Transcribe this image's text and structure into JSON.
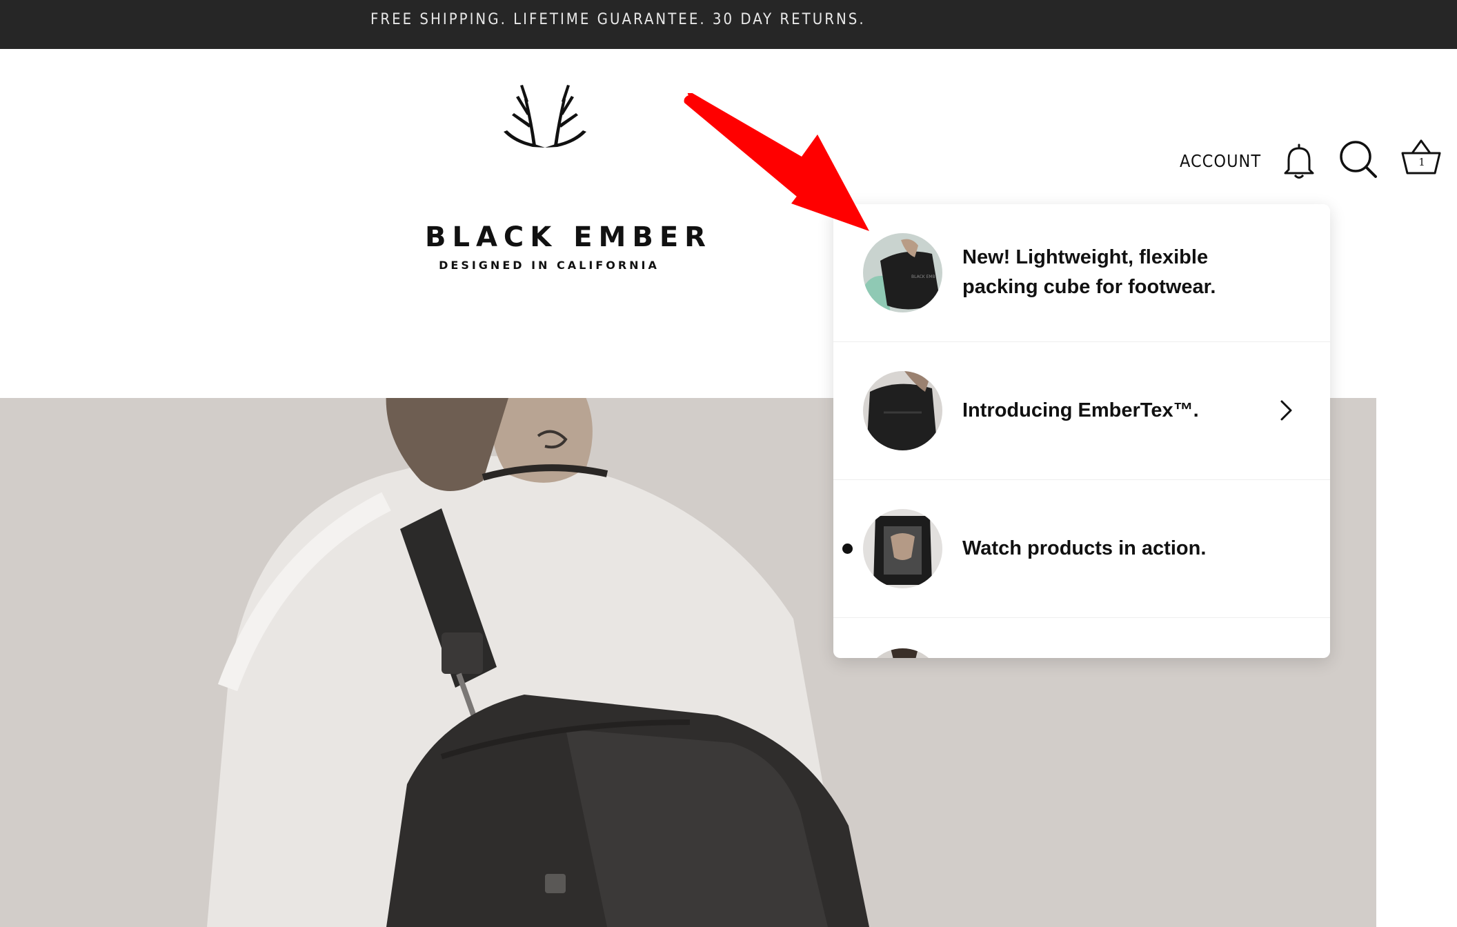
{
  "announcement": {
    "text": "FREE SHIPPING. LIFETIME GUARANTEE. 30 DAY RETURNS."
  },
  "brand": {
    "name": "BLACK EMBER",
    "tagline": "DESIGNED IN CALIFORNIA",
    "logo_icon": "antlers-logo"
  },
  "nav": {
    "account_label": "ACCOUNT",
    "icons": [
      "bell-icon",
      "search-icon",
      "basket-icon"
    ],
    "cart_count": "1"
  },
  "notifications": {
    "items": [
      {
        "line1": "New! Lightweight, flexible",
        "line2": "packing cube for footwear.",
        "has_chevron": false,
        "unread": false
      },
      {
        "line1": "Introducing EmberTex™.",
        "has_chevron": true,
        "unread": false
      },
      {
        "line1": "Watch products in action.",
        "has_chevron": false,
        "unread": true
      }
    ]
  },
  "colors": {
    "announce_bg": "#262626",
    "hero_bg": "#d1ccc8",
    "annotation_arrow": "#ff0000"
  }
}
